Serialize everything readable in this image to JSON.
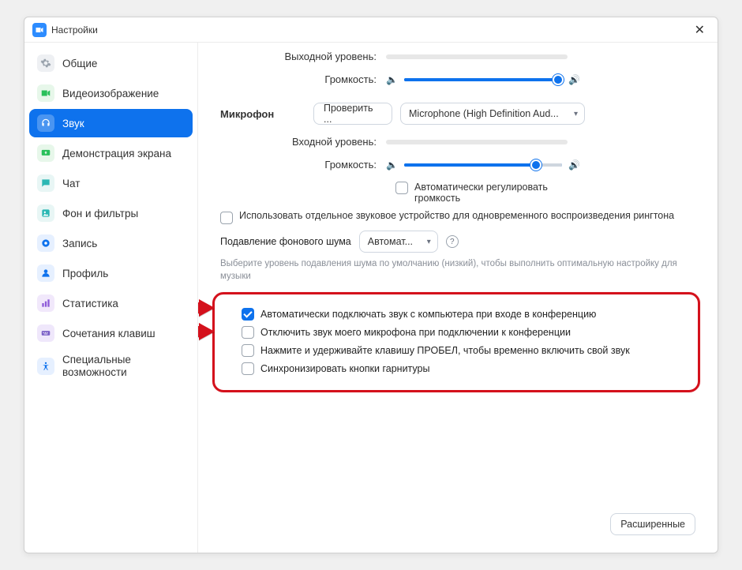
{
  "window": {
    "title": "Настройки"
  },
  "sidebar": {
    "items": [
      {
        "label": "Общие"
      },
      {
        "label": "Видеоизображение"
      },
      {
        "label": "Звук"
      },
      {
        "label": "Демонстрация экрана"
      },
      {
        "label": "Чат"
      },
      {
        "label": "Фон и фильтры"
      },
      {
        "label": "Запись"
      },
      {
        "label": "Профиль"
      },
      {
        "label": "Статистика"
      },
      {
        "label": "Сочетания клавиш"
      },
      {
        "label": "Специальные возможности"
      }
    ]
  },
  "speaker": {
    "output_level_label": "Выходной уровень:",
    "volume_label": "Громкость:"
  },
  "mic": {
    "section_label": "Микрофон",
    "test_btn": "Проверить ...",
    "device": "Microphone (High Definition Aud...",
    "input_level_label": "Входной уровень:",
    "volume_label": "Громкость:",
    "auto_adjust": "Автоматически регулировать громкость"
  },
  "ringtone": {
    "label": "Использовать отдельное звуковое устройство для одновременного воспроизведения рингтона"
  },
  "noise": {
    "label": "Подавление фонового шума",
    "select": "Автомат...",
    "hint": "Выберите уровень подавления шума по умолчанию (низкий), чтобы выполнить оптимальную настройку для музыки"
  },
  "options": [
    {
      "label": "Автоматически подключать звук с компьютера при входе в конференцию",
      "checked": true
    },
    {
      "label": "Отключить звук моего микрофона при подключении к конференции",
      "checked": false
    },
    {
      "label": "Нажмите и удерживайте клавишу ПРОБЕЛ, чтобы временно включить свой звук",
      "checked": false
    },
    {
      "label": "Синхронизировать кнопки гарнитуры",
      "checked": false
    }
  ],
  "advanced_btn": "Расширенные"
}
